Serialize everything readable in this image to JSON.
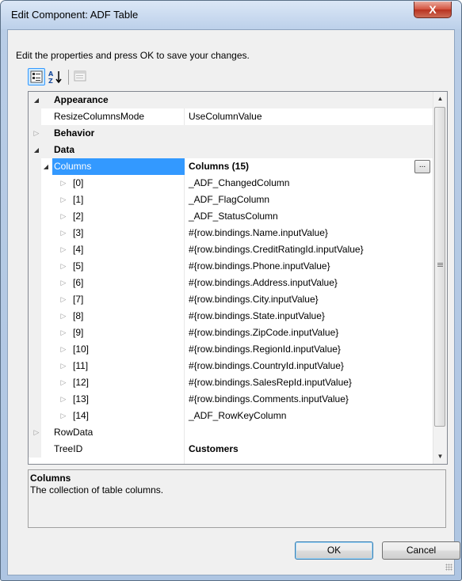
{
  "window": {
    "title": "Edit Component: ADF Table",
    "close_label": "X"
  },
  "instructions": "Edit the properties and press OK to save your changes.",
  "toolbar": {
    "buttons": [
      {
        "name": "categorized-view-icon",
        "active": true
      },
      {
        "name": "alphabetical-sort-icon",
        "active": false
      },
      {
        "name": "property-pages-icon",
        "active": false
      }
    ]
  },
  "property_grid": {
    "categories": {
      "appearance": "Appearance",
      "behavior": "Behavior",
      "data": "Data"
    },
    "resize_mode": {
      "name": "ResizeColumnsMode",
      "value": "UseColumnValue"
    },
    "columns": {
      "name": "Columns",
      "value": "Columns (15)",
      "button": "..."
    },
    "column_items": [
      {
        "index": "[0]",
        "value": "_ADF_ChangedColumn"
      },
      {
        "index": "[1]",
        "value": "_ADF_FlagColumn"
      },
      {
        "index": "[2]",
        "value": "_ADF_StatusColumn"
      },
      {
        "index": "[3]",
        "value": "#{row.bindings.Name.inputValue}"
      },
      {
        "index": "[4]",
        "value": "#{row.bindings.CreditRatingId.inputValue}"
      },
      {
        "index": "[5]",
        "value": "#{row.bindings.Phone.inputValue}"
      },
      {
        "index": "[6]",
        "value": "#{row.bindings.Address.inputValue}"
      },
      {
        "index": "[7]",
        "value": "#{row.bindings.City.inputValue}"
      },
      {
        "index": "[8]",
        "value": "#{row.bindings.State.inputValue}"
      },
      {
        "index": "[9]",
        "value": "#{row.bindings.ZipCode.inputValue}"
      },
      {
        "index": "[10]",
        "value": "#{row.bindings.RegionId.inputValue}"
      },
      {
        "index": "[11]",
        "value": "#{row.bindings.CountryId.inputValue}"
      },
      {
        "index": "[12]",
        "value": "#{row.bindings.SalesRepId.inputValue}"
      },
      {
        "index": "[13]",
        "value": "#{row.bindings.Comments.inputValue}"
      },
      {
        "index": "[14]",
        "value": "_ADF_RowKeyColumn"
      }
    ],
    "row_data": {
      "name": "RowData",
      "value": ""
    },
    "tree_id": {
      "name": "TreeID",
      "value": "Customers"
    }
  },
  "help": {
    "title": "Columns",
    "description": "The collection of table columns."
  },
  "buttons": {
    "ok": "OK",
    "cancel": "Cancel"
  },
  "colors": {
    "selection": "#3399ff",
    "title_bar": "#bcd0ea",
    "close_button": "#c4412d"
  }
}
